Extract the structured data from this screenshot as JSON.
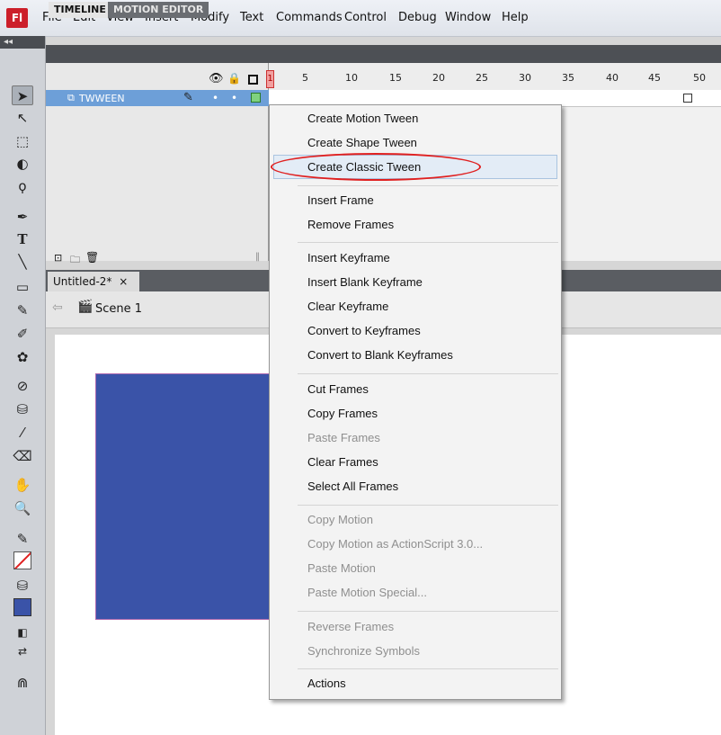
{
  "app": {
    "logo_text": "Fl"
  },
  "menubar": {
    "items": [
      "File",
      "Edit",
      "View",
      "Insert",
      "Modify",
      "Text",
      "Commands",
      "Control",
      "Debug",
      "Window",
      "Help"
    ]
  },
  "panel": {
    "tabs": [
      "TIMELINE",
      "MOTION EDITOR"
    ]
  },
  "timeline": {
    "layer_name": "TWWEEN",
    "frame_numbers": [
      "5",
      "10",
      "15",
      "20",
      "25",
      "30",
      "35",
      "40",
      "45",
      "50"
    ],
    "current_frame": "1"
  },
  "document": {
    "tab_title": "Untitled-2*",
    "close_glyph": "×",
    "scene": "Scene 1"
  },
  "context_menu": {
    "items": [
      {
        "label": "Create Motion Tween",
        "enabled": true
      },
      {
        "label": "Create Shape Tween",
        "enabled": true
      },
      {
        "label": "Create Classic Tween",
        "enabled": true,
        "highlighted": true
      },
      {
        "label": "Insert Frame",
        "enabled": true
      },
      {
        "label": "Remove Frames",
        "enabled": true
      },
      {
        "label": "Insert Keyframe",
        "enabled": true
      },
      {
        "label": "Insert Blank Keyframe",
        "enabled": true
      },
      {
        "label": "Clear Keyframe",
        "enabled": true
      },
      {
        "label": "Convert to Keyframes",
        "enabled": true
      },
      {
        "label": "Convert to Blank Keyframes",
        "enabled": true
      },
      {
        "label": "Cut Frames",
        "enabled": true
      },
      {
        "label": "Copy Frames",
        "enabled": true
      },
      {
        "label": "Paste Frames",
        "enabled": false
      },
      {
        "label": "Clear Frames",
        "enabled": true
      },
      {
        "label": "Select All Frames",
        "enabled": true
      },
      {
        "label": "Copy Motion",
        "enabled": false
      },
      {
        "label": "Copy Motion as ActionScript 3.0...",
        "enabled": false
      },
      {
        "label": "Paste Motion",
        "enabled": false
      },
      {
        "label": "Paste Motion Special...",
        "enabled": false
      },
      {
        "label": "Reverse Frames",
        "enabled": false
      },
      {
        "label": "Synchronize Symbols",
        "enabled": false
      },
      {
        "label": "Actions",
        "enabled": true
      }
    ]
  },
  "colors": {
    "stage_rect": "#3a53a8",
    "annotation": "#e02020",
    "fill_swatch": "#3a53a8"
  }
}
